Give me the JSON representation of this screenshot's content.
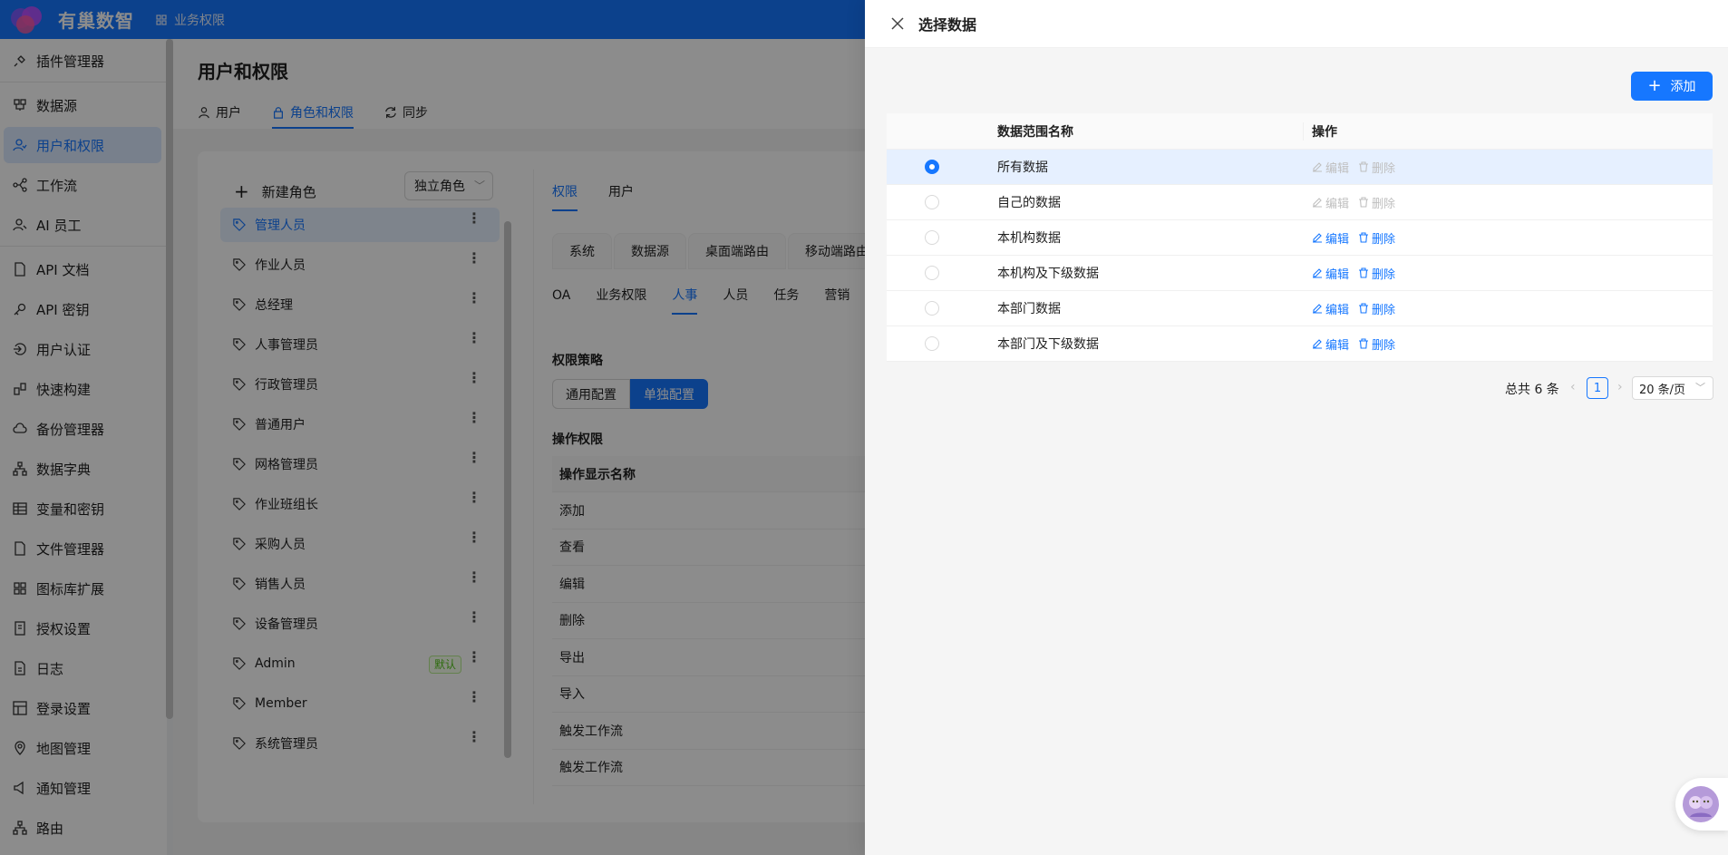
{
  "app": {
    "brand": "有巢数智",
    "breadcrumb": "业务权限"
  },
  "sidebar": {
    "items": [
      {
        "label": "插件管理器",
        "icon": "plugin-icon"
      },
      {
        "label": "数据源",
        "icon": "database-icon"
      },
      {
        "label": "用户和权限",
        "icon": "users-icon",
        "active": true
      },
      {
        "label": "工作流",
        "icon": "workflow-icon"
      },
      {
        "label": "AI 员工",
        "icon": "ai-employee-icon"
      },
      {
        "label": "API 文档",
        "icon": "document-icon"
      },
      {
        "label": "API 密钥",
        "icon": "key-icon"
      },
      {
        "label": "用户认证",
        "icon": "login-icon"
      },
      {
        "label": "快速构建",
        "icon": "build-icon"
      },
      {
        "label": "备份管理器",
        "icon": "cloud-icon"
      },
      {
        "label": "数据字典",
        "icon": "tree-icon"
      },
      {
        "label": "变量和密钥",
        "icon": "table-icon"
      },
      {
        "label": "文件管理器",
        "icon": "file-icon"
      },
      {
        "label": "图标库扩展",
        "icon": "grid-icon"
      },
      {
        "label": "授权设置",
        "icon": "license-icon"
      },
      {
        "label": "日志",
        "icon": "log-icon"
      },
      {
        "label": "登录设置",
        "icon": "login-settings-icon"
      },
      {
        "label": "地图管理",
        "icon": "location-icon"
      },
      {
        "label": "通知管理",
        "icon": "notification-icon"
      },
      {
        "label": "路由",
        "icon": "route-icon"
      }
    ]
  },
  "page": {
    "title": "用户和权限",
    "tabs": [
      {
        "label": "用户",
        "icon": "user-icon"
      },
      {
        "label": "角色和权限",
        "icon": "lock-icon",
        "active": true
      },
      {
        "label": "同步",
        "icon": "sync-icon"
      }
    ]
  },
  "roles": {
    "new_label": "新建角色",
    "mode_select": "独立角色",
    "items": [
      {
        "label": "管理人员",
        "active": true
      },
      {
        "label": "作业人员"
      },
      {
        "label": "总经理"
      },
      {
        "label": "人事管理员"
      },
      {
        "label": "行政管理员"
      },
      {
        "label": "普通用户"
      },
      {
        "label": "网格管理员"
      },
      {
        "label": "作业班组长"
      },
      {
        "label": "采购人员"
      },
      {
        "label": "销售人员"
      },
      {
        "label": "设备管理员"
      },
      {
        "label": "Admin",
        "badge": "默认"
      },
      {
        "label": "Member"
      },
      {
        "label": "系统管理员"
      }
    ]
  },
  "permissions": {
    "tabs": [
      "权限",
      "用户"
    ],
    "card_tabs": [
      "系统",
      "数据源",
      "桌面端路由",
      "移动端路由"
    ],
    "sub_tabs": [
      "OA",
      "业务权限",
      "人事",
      "人员",
      "任务",
      "营销"
    ],
    "active_sub_tab": "人事",
    "strategy_label": "权限策略",
    "strategy_options": [
      "通用配置",
      "单独配置"
    ],
    "ops_label": "操作权限",
    "ops_header": "操作显示名称",
    "ops_rows": [
      "添加",
      "查看",
      "编辑",
      "删除",
      "导出",
      "导入",
      "触发工作流",
      "触发工作流"
    ]
  },
  "drawer": {
    "title": "选择数据",
    "add_label": "添加",
    "columns": {
      "name": "数据范围名称",
      "ops": "操作"
    },
    "edit_label": "编辑",
    "delete_label": "删除",
    "rows": [
      {
        "name": "所有数据",
        "selected": true,
        "disabled": true
      },
      {
        "name": "自己的数据",
        "selected": false,
        "disabled": true
      },
      {
        "name": "本机构数据",
        "selected": false,
        "disabled": false
      },
      {
        "name": "本机构及下级数据",
        "selected": false,
        "disabled": false
      },
      {
        "name": "本部门数据",
        "selected": false,
        "disabled": false
      },
      {
        "name": "本部门及下级数据",
        "selected": false,
        "disabled": false
      }
    ],
    "pagination": {
      "total_text": "总共 6 条",
      "current_page": "1",
      "page_size": "20 条/页"
    }
  },
  "colors": {
    "primary": "#1677ff",
    "mask": "rgba(0,0,0,0.45)",
    "success": "#52c41a"
  }
}
